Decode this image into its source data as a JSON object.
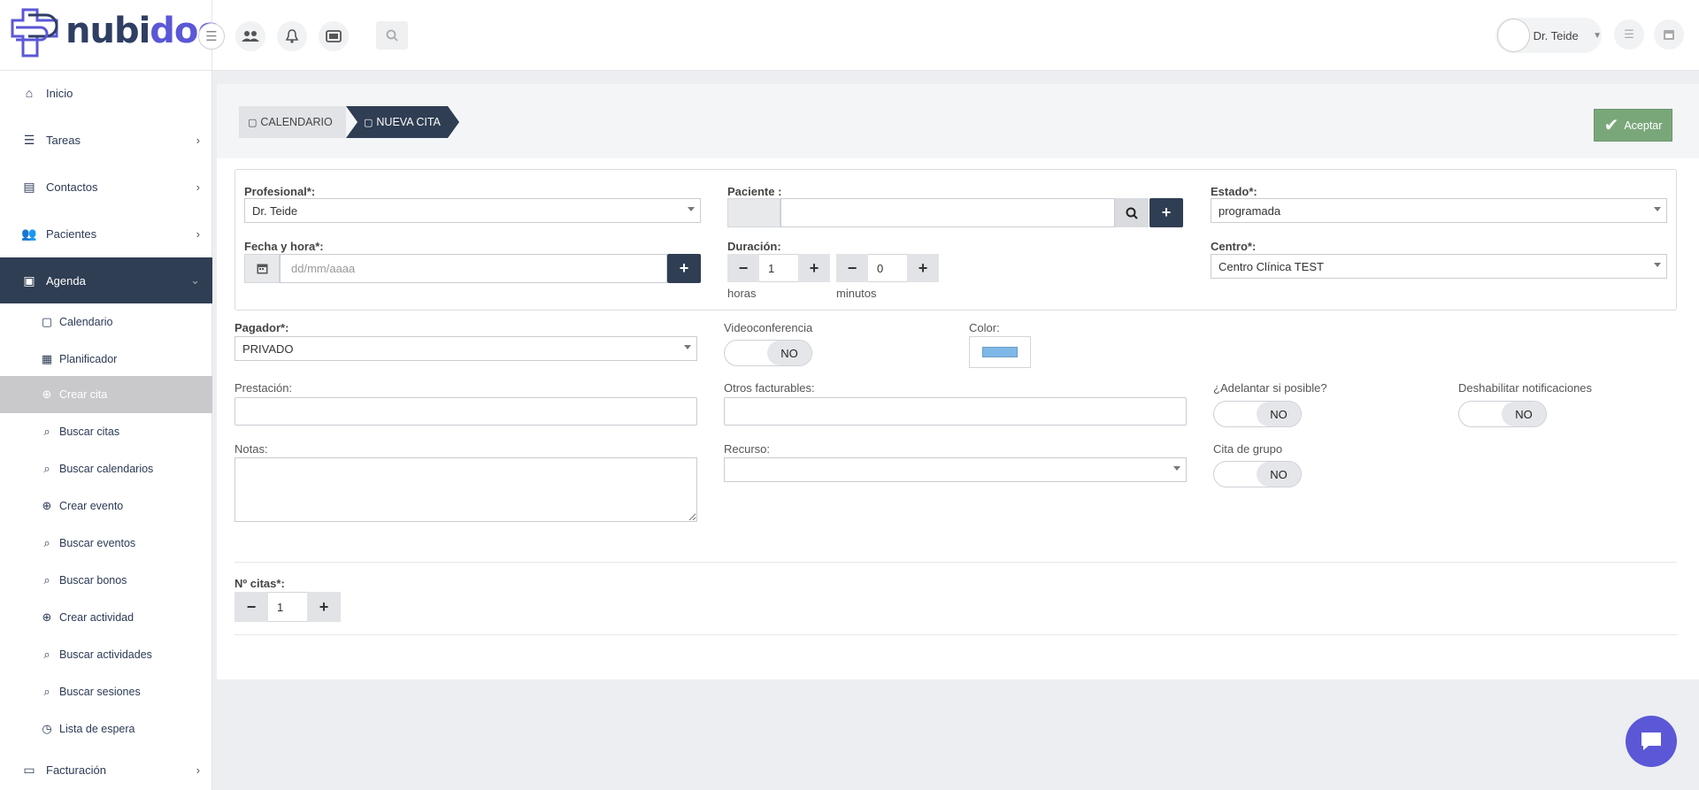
{
  "brand": {
    "part1": "nubi",
    "part2": "doc",
    "primary": "#2f3e63",
    "accent": "#5b57d6"
  },
  "topbar": {
    "icons": [
      "users-icon",
      "bell-icon",
      "ticket-icon",
      "search-icon"
    ],
    "user_name": "Dr. Teide"
  },
  "sidebar": {
    "items": [
      {
        "label": "Inicio",
        "icon": "home-icon"
      },
      {
        "label": "Tareas",
        "icon": "list-icon"
      },
      {
        "label": "Contactos",
        "icon": "address-book-icon"
      },
      {
        "label": "Pacientes",
        "icon": "users-icon"
      },
      {
        "label": "Agenda",
        "icon": "calendar-icon"
      },
      {
        "label": "Facturación",
        "icon": "money-icon"
      }
    ],
    "agenda_sub": [
      {
        "label": "Calendario",
        "icon": "calendar-icon"
      },
      {
        "label": "Planificador",
        "icon": "calendar-grid-icon"
      },
      {
        "label": "Crear cita",
        "icon": "plus-circle-icon"
      },
      {
        "label": "Buscar citas",
        "icon": "search-icon"
      },
      {
        "label": "Buscar calendarios",
        "icon": "search-icon"
      },
      {
        "label": "Crear evento",
        "icon": "plus-circle-icon"
      },
      {
        "label": "Buscar eventos",
        "icon": "search-icon"
      },
      {
        "label": "Buscar bonos",
        "icon": "search-icon"
      },
      {
        "label": "Crear actividad",
        "icon": "plus-circle-icon"
      },
      {
        "label": "Buscar actividades",
        "icon": "search-icon"
      },
      {
        "label": "Buscar sesiones",
        "icon": "search-icon"
      },
      {
        "label": "Lista de espera",
        "icon": "clock-icon"
      }
    ]
  },
  "breadcrumb": {
    "first": "CALENDARIO",
    "second": "NUEVA CITA"
  },
  "accept_label": "Aceptar",
  "form": {
    "profesional_label": "Profesional*:",
    "profesional_value": "Dr. Teide",
    "paciente_label": "Paciente :",
    "estado_label": "Estado*:",
    "estado_value": "programada",
    "fecha_label": "Fecha y hora*:",
    "fecha_placeholder": "dd/mm/aaaa",
    "duracion_label": "Duración:",
    "horas_value": "1",
    "horas_label": "horas",
    "minutos_value": "0",
    "minutos_label": "minutos",
    "centro_label": "Centro*:",
    "centro_value": "Centro Clínica TEST",
    "pagador_label": "Pagador*:",
    "pagador_value": "PRIVADO",
    "videoconf_label": "Videoconferencia",
    "videoconf_value": "NO",
    "color_label": "Color:",
    "color_value": "#7fb8e8",
    "prestacion_label": "Prestación:",
    "otros_label": "Otros facturables:",
    "adelantar_label": "¿Adelantar si posible?",
    "adelantar_value": "NO",
    "deshab_label": "Deshabilitar notificaciones",
    "deshab_value": "NO",
    "notas_label": "Notas:",
    "recurso_label": "Recurso:",
    "grupo_label": "Cita de grupo",
    "grupo_value": "NO",
    "ncitas_label": "Nº citas*:",
    "ncitas_value": "1"
  }
}
